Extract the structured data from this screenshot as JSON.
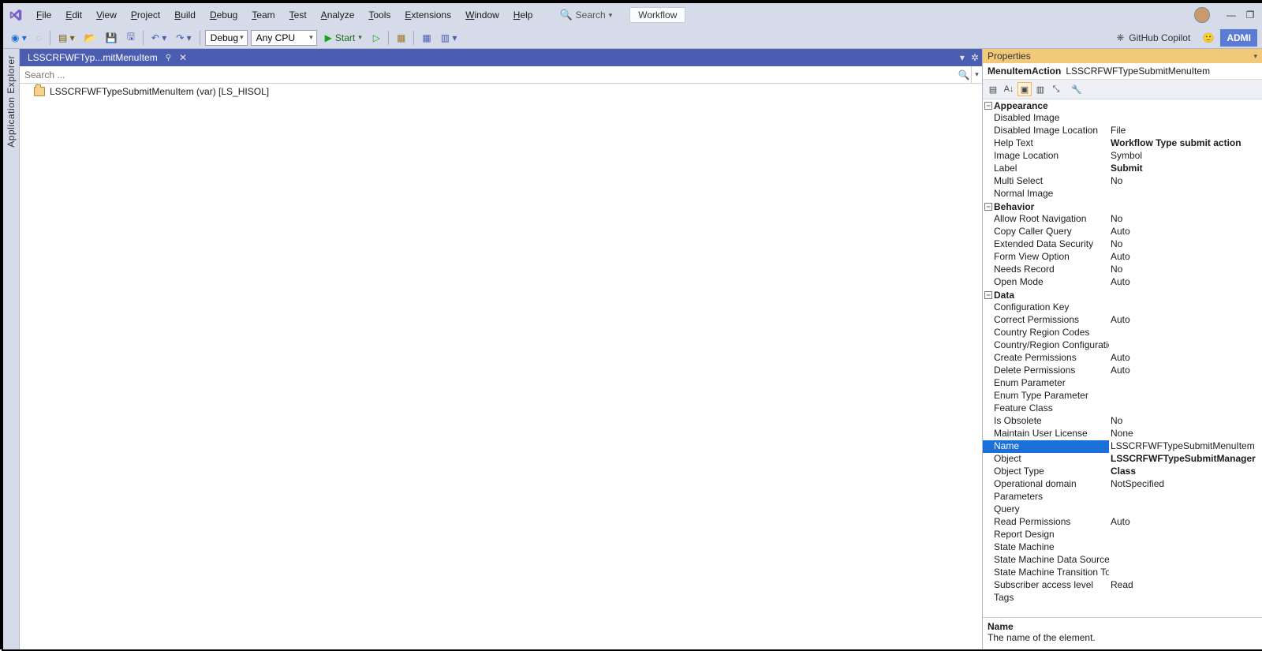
{
  "menu": {
    "items": [
      "File",
      "Edit",
      "View",
      "Project",
      "Build",
      "Debug",
      "Team",
      "Test",
      "Analyze",
      "Tools",
      "Extensions",
      "Window",
      "Help"
    ],
    "search_label": "Search",
    "workflow_label": "Workflow"
  },
  "window_controls": {
    "min": "—",
    "restore": "❐"
  },
  "toolbar": {
    "config": "Debug",
    "platform": "Any CPU",
    "start_label": "Start",
    "copilot_label": "GitHub Copilot",
    "admin_label": "ADMI"
  },
  "left_rail": "Application Explorer",
  "tab": {
    "title": "LSSCRFWFTyp...mitMenuItem",
    "pinned_glyph": "⚲",
    "close_glyph": "✕"
  },
  "search": {
    "placeholder": "Search ..."
  },
  "doc_item": "LSSCRFWFTypeSubmitMenuItem (var) [LS_HISOL]",
  "props": {
    "panel_title": "Properties",
    "object_type": "MenuItemAction",
    "object_name": "LSSCRFWFTypeSubmitMenuItem",
    "categories": [
      {
        "name": "Appearance",
        "rows": [
          {
            "n": "Disabled Image",
            "v": ""
          },
          {
            "n": "Disabled Image Location",
            "v": "File"
          },
          {
            "n": "Help Text",
            "v": "Workflow Type submit action",
            "bold": true
          },
          {
            "n": "Image Location",
            "v": "Symbol"
          },
          {
            "n": "Label",
            "v": "Submit",
            "bold": true
          },
          {
            "n": "Multi Select",
            "v": "No"
          },
          {
            "n": "Normal Image",
            "v": ""
          }
        ]
      },
      {
        "name": "Behavior",
        "rows": [
          {
            "n": "Allow Root Navigation",
            "v": "No"
          },
          {
            "n": "Copy Caller Query",
            "v": "Auto"
          },
          {
            "n": "Extended Data Security",
            "v": "No"
          },
          {
            "n": "Form View Option",
            "v": "Auto"
          },
          {
            "n": "Needs Record",
            "v": "No"
          },
          {
            "n": "Open Mode",
            "v": "Auto"
          }
        ]
      },
      {
        "name": "Data",
        "rows": [
          {
            "n": "Configuration Key",
            "v": ""
          },
          {
            "n": "Correct Permissions",
            "v": "Auto"
          },
          {
            "n": "Country Region Codes",
            "v": ""
          },
          {
            "n": "Country/Region Configuration Key",
            "v": ""
          },
          {
            "n": "Create Permissions",
            "v": "Auto"
          },
          {
            "n": "Delete Permissions",
            "v": "Auto"
          },
          {
            "n": "Enum Parameter",
            "v": ""
          },
          {
            "n": "Enum Type Parameter",
            "v": ""
          },
          {
            "n": "Feature Class",
            "v": ""
          },
          {
            "n": "Is Obsolete",
            "v": "No"
          },
          {
            "n": "Maintain User License",
            "v": "None"
          },
          {
            "n": "Name",
            "v": "LSSCRFWFTypeSubmitMenuItem",
            "selected": true
          },
          {
            "n": "Object",
            "v": "LSSCRFWFTypeSubmitManager",
            "bold": true
          },
          {
            "n": "Object Type",
            "v": "Class",
            "bold": true
          },
          {
            "n": "Operational domain",
            "v": "NotSpecified"
          },
          {
            "n": "Parameters",
            "v": ""
          },
          {
            "n": "Query",
            "v": ""
          },
          {
            "n": "Read Permissions",
            "v": "Auto"
          },
          {
            "n": "Report Design",
            "v": ""
          },
          {
            "n": "State Machine",
            "v": ""
          },
          {
            "n": "State Machine Data Source",
            "v": ""
          },
          {
            "n": "State Machine Transition To",
            "v": ""
          },
          {
            "n": "Subscriber access level",
            "v": "Read"
          },
          {
            "n": "Tags",
            "v": ""
          }
        ]
      }
    ],
    "desc_name": "Name",
    "desc_text": "The name of the element."
  }
}
